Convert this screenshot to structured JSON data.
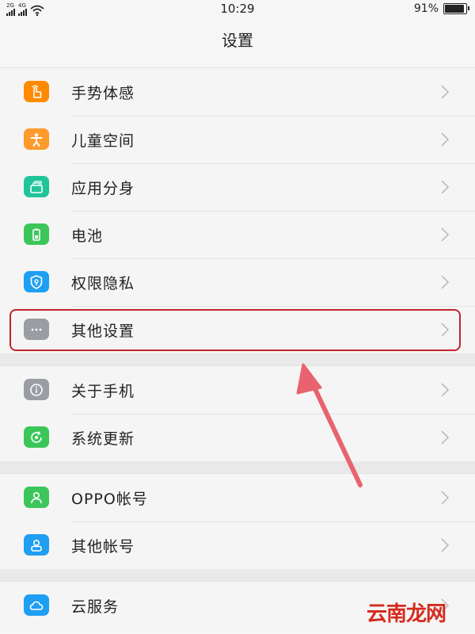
{
  "status": {
    "sim1_tag": "2G",
    "sim2_tag": "4G",
    "time": "10:29",
    "battery_pct": "91%",
    "battery_level": 0.91
  },
  "header": {
    "title": "设置"
  },
  "groups": [
    {
      "items": [
        {
          "label": "手势体感",
          "icon": "hand-gesture-icon",
          "color": "#ff8a00"
        },
        {
          "label": "儿童空间",
          "icon": "child-icon",
          "color": "#ff9a2c"
        },
        {
          "label": "应用分身",
          "icon": "app-clone-icon",
          "color": "#1fc49a"
        },
        {
          "label": "电池",
          "icon": "battery-icon",
          "color": "#3cc65a"
        },
        {
          "label": "权限隐私",
          "icon": "shield-lock-icon",
          "color": "#1f9ff2"
        },
        {
          "label": "其他设置",
          "icon": "more-dots-icon",
          "color": "#9a9da3"
        }
      ]
    },
    {
      "items": [
        {
          "label": "关于手机",
          "icon": "info-icon",
          "color": "#9a9da3"
        },
        {
          "label": "系统更新",
          "icon": "update-icon",
          "color": "#3cc65a"
        }
      ]
    },
    {
      "items": [
        {
          "label": "OPPO帐号",
          "icon": "person-icon",
          "color": "#3cc65a"
        },
        {
          "label": "其他帐号",
          "icon": "account-icon",
          "color": "#1f9ff2"
        }
      ]
    },
    {
      "items": [
        {
          "label": "云服务",
          "icon": "cloud-icon",
          "color": "#1f9ff2"
        }
      ]
    }
  ],
  "watermark": "云南龙网",
  "colors": {
    "highlight": "#c1252d",
    "arrow": "#e8636f"
  }
}
